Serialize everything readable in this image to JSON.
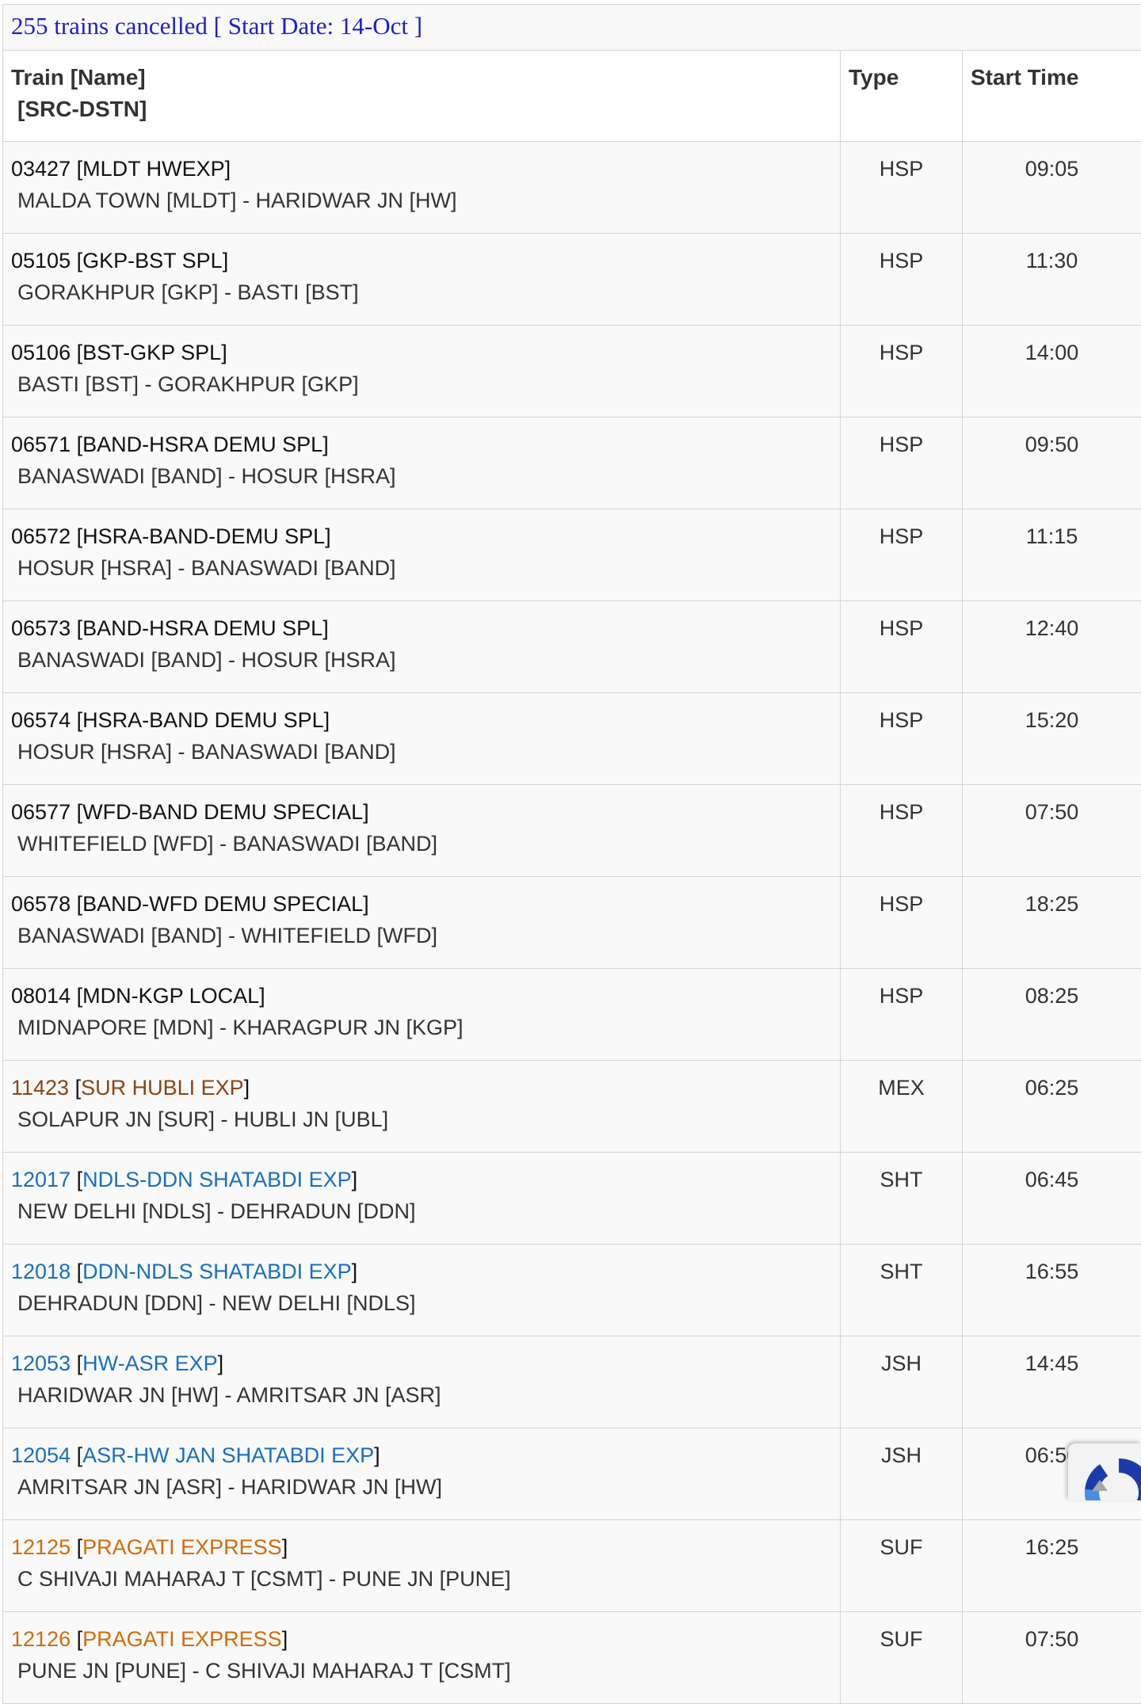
{
  "caption": "255 trains cancelled [ Start Date: 14-Oct ]",
  "headers": {
    "train_line1": "Train [Name]",
    "train_line2": "[SRC-DSTN]",
    "type": "Type",
    "start_time": "Start Time"
  },
  "colors": {
    "caption": "#1f20c8",
    "default": "#111111",
    "MEX": "#8b4513",
    "SHT": "#1a6fbf",
    "JSH": "#1a6fbf",
    "SUF": "#d46b0a"
  },
  "icons": {
    "badge": "recaptcha-icon"
  },
  "rows": [
    {
      "no": "03427",
      "name": "MLDT HWEXP",
      "route": "MALDA TOWN [MLDT] - HARIDWAR JN [HW]",
      "type": "HSP",
      "time": "09:05"
    },
    {
      "no": "05105",
      "name": "GKP-BST SPL",
      "route": "GORAKHPUR [GKP] - BASTI [BST]",
      "type": "HSP",
      "time": "11:30"
    },
    {
      "no": "05106",
      "name": "BST-GKP SPL",
      "route": "BASTI [BST] - GORAKHPUR [GKP]",
      "type": "HSP",
      "time": "14:00"
    },
    {
      "no": "06571",
      "name": "BAND-HSRA DEMU SPL",
      "route": "BANASWADI [BAND] - HOSUR [HSRA]",
      "type": "HSP",
      "time": "09:50"
    },
    {
      "no": "06572",
      "name": "HSRA-BAND-DEMU SPL",
      "route": "HOSUR [HSRA] - BANASWADI [BAND]",
      "type": "HSP",
      "time": "11:15"
    },
    {
      "no": "06573",
      "name": "BAND-HSRA DEMU SPL",
      "route": "BANASWADI [BAND] - HOSUR [HSRA]",
      "type": "HSP",
      "time": "12:40"
    },
    {
      "no": "06574",
      "name": "HSRA-BAND DEMU SPL",
      "route": "HOSUR [HSRA] - BANASWADI [BAND]",
      "type": "HSP",
      "time": "15:20"
    },
    {
      "no": "06577",
      "name": "WFD-BAND DEMU SPECIAL",
      "route": "WHITEFIELD [WFD] - BANASWADI [BAND]",
      "type": "HSP",
      "time": "07:50"
    },
    {
      "no": "06578",
      "name": "BAND-WFD DEMU SPECIAL",
      "route": "BANASWADI [BAND] - WHITEFIELD [WFD]",
      "type": "HSP",
      "time": "18:25"
    },
    {
      "no": "08014",
      "name": "MDN-KGP LOCAL",
      "route": "MIDNAPORE [MDN] - KHARAGPUR JN [KGP]",
      "type": "HSP",
      "time": "08:25"
    },
    {
      "no": "11423",
      "name": "SUR HUBLI EXP",
      "route": "SOLAPUR JN [SUR] - HUBLI JN [UBL]",
      "type": "MEX",
      "time": "06:25"
    },
    {
      "no": "12017",
      "name": "NDLS-DDN SHATABDI EXP",
      "route": "NEW DELHI [NDLS] - DEHRADUN [DDN]",
      "type": "SHT",
      "time": "06:45"
    },
    {
      "no": "12018",
      "name": "DDN-NDLS SHATABDI EXP",
      "route": "DEHRADUN [DDN] - NEW DELHI [NDLS]",
      "type": "SHT",
      "time": "16:55"
    },
    {
      "no": "12053",
      "name": "HW-ASR EXP",
      "route": "HARIDWAR JN [HW] - AMRITSAR JN [ASR]",
      "type": "JSH",
      "time": "14:45"
    },
    {
      "no": "12054",
      "name": "ASR-HW JAN SHATABDI EXP",
      "route": "AMRITSAR JN [ASR] - HARIDWAR JN [HW]",
      "type": "JSH",
      "time": "06:50"
    },
    {
      "no": "12125",
      "name": "PRAGATI EXPRESS",
      "route": "C SHIVAJI MAHARAJ T [CSMT] - PUNE JN [PUNE]",
      "type": "SUF",
      "time": "16:25"
    },
    {
      "no": "12126",
      "name": "PRAGATI EXPRESS",
      "route": "PUNE JN [PUNE] - C SHIVAJI MAHARAJ T [CSMT]",
      "type": "SUF",
      "time": "07:50"
    }
  ]
}
